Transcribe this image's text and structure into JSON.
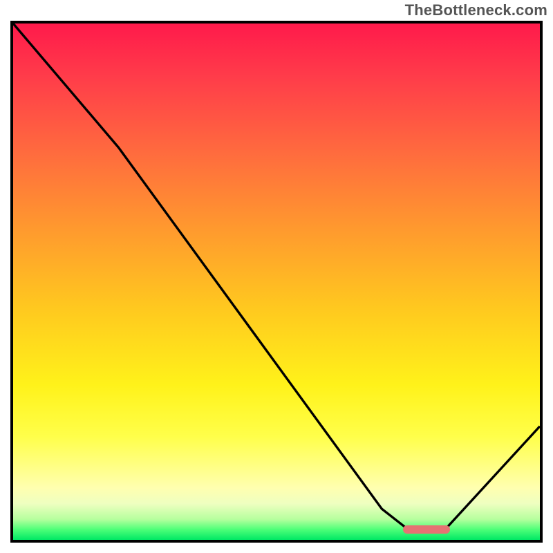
{
  "watermark": "TheBottleneck.com",
  "colors": {
    "frame": "#000000",
    "curve": "#000000",
    "marker": "#e57373",
    "gradient_top": "#ff1a4b",
    "gradient_bottom": "#00e865"
  },
  "chart_data": {
    "type": "line",
    "title": "",
    "xlabel": "",
    "ylabel": "",
    "xlim": [
      0,
      100
    ],
    "ylim": [
      0,
      100
    ],
    "grid": false,
    "series": [
      {
        "name": "bottleneck-curve",
        "x": [
          0,
          20,
          70,
          75,
          82,
          100
        ],
        "y": [
          100,
          76,
          6,
          2,
          2,
          22
        ]
      }
    ],
    "annotations": [
      {
        "name": "optimal-range-marker",
        "x_start": 74,
        "x_end": 83,
        "y": 2
      }
    ]
  }
}
